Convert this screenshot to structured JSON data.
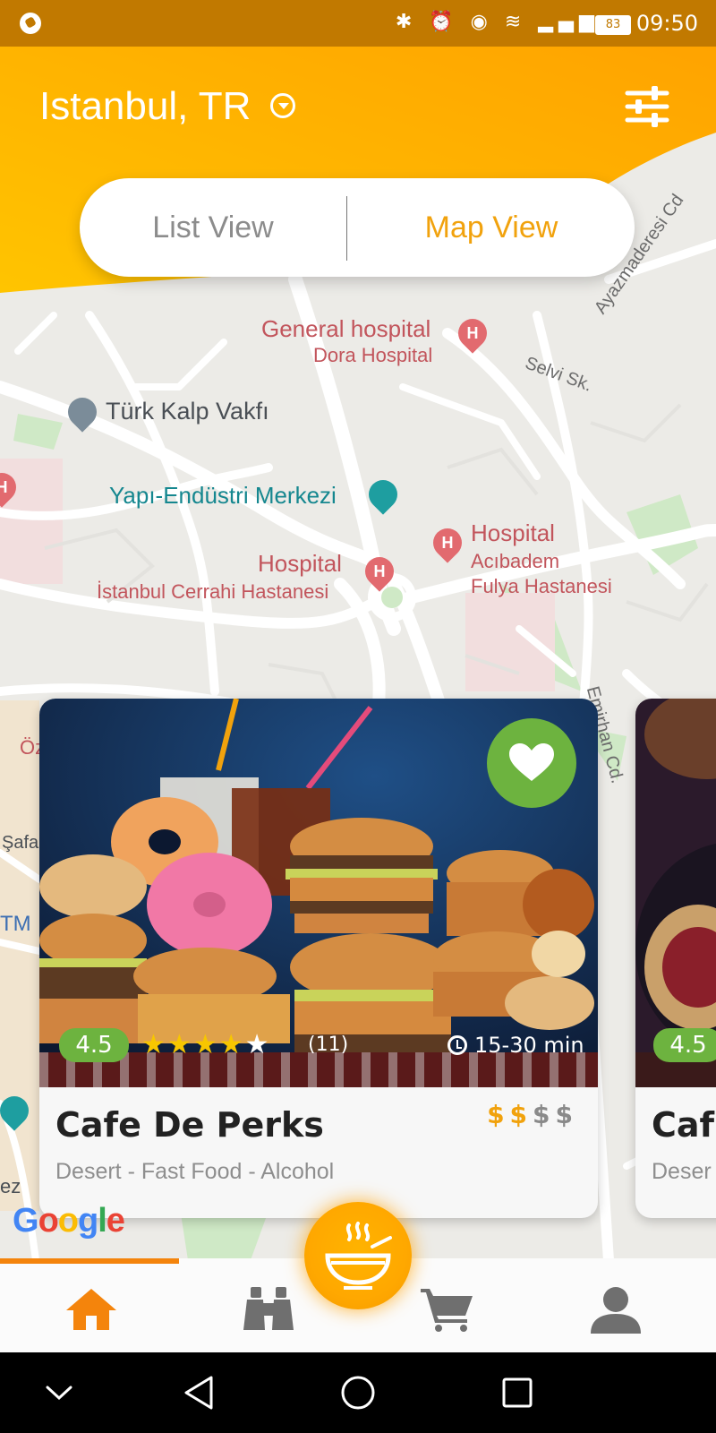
{
  "status_bar": {
    "battery": "83",
    "time": "09:50",
    "icons": [
      "call-icon",
      "bluetooth-icon",
      "alarm-icon",
      "eye-icon",
      "wifi-icon",
      "signal-icon",
      "battery-icon"
    ]
  },
  "header": {
    "location": "Istanbul, TR",
    "filter_icon": "filter-sliders-icon",
    "accent_color": "#ffa800"
  },
  "view_toggle": {
    "list_label": "List View",
    "map_label": "Map View",
    "active": "Map View"
  },
  "map": {
    "labels": {
      "general_hospital": "General hospital",
      "dora_hospital": "Dora Hospital",
      "selvi": "Selvi Sk.",
      "ayazmaderesi": "Ayazmaderesi Cd",
      "turk_kalp": "Türk Kalp Vakfı",
      "yapi": "Yapı-Endüstri Merkezi",
      "hospital_1": "Hospital",
      "istanbul_cerrahi": "İstanbul Cerrahi Hastanesi",
      "hospital_2": "Hospital",
      "acibadem": "Acıbadem",
      "fulya": "Fulya Hastanesi",
      "emirhan": "Emirhan Cd.",
      "oz": "Öz",
      "safa": "Şafa",
      "tm": "TM",
      "ez": "ez"
    },
    "google": "Google"
  },
  "cards": [
    {
      "name": "Cafe De Perks",
      "rating": "4.5",
      "stars": 4.5,
      "reviews": "(11)",
      "delivery_time": "15-30 min",
      "price_level": 2,
      "price_max": 4,
      "cuisine": "Desert - Fast Food - Alcohol",
      "favorite": true
    },
    {
      "name": "Caf",
      "rating": "4.5",
      "cuisine": "Deser"
    }
  ],
  "bottom_nav": {
    "items": [
      "home-icon",
      "binoculars-icon",
      "noodle-bowl-icon",
      "cart-icon",
      "user-icon"
    ],
    "active": "home-icon"
  },
  "colors": {
    "orange": "#ffa800",
    "status_orange": "#c17900",
    "green": "#6db33f",
    "map_view_text": "#f1a20d"
  }
}
